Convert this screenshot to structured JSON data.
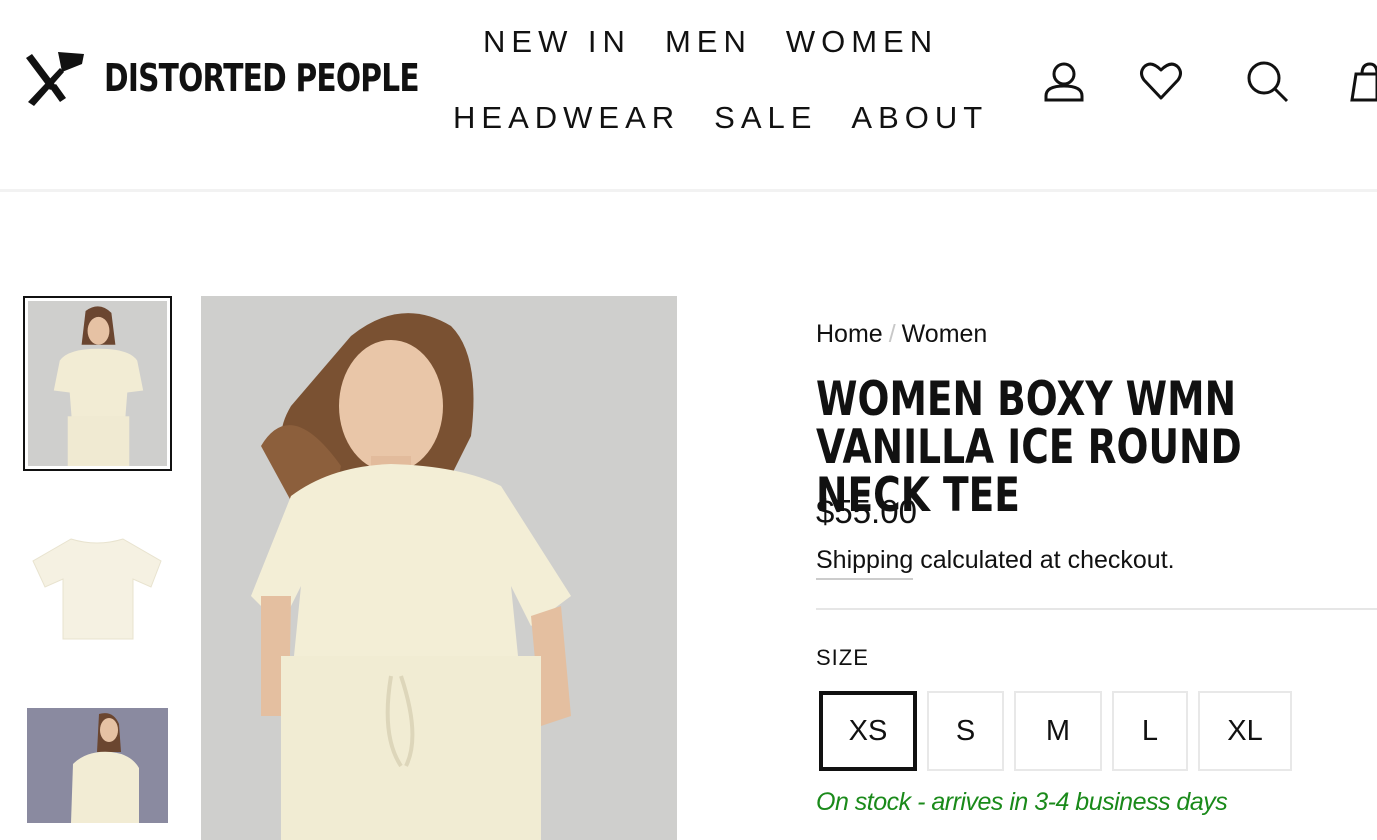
{
  "brand": {
    "name": "DISTORTED PEOPLE"
  },
  "nav": {
    "row1": [
      "NEW IN",
      "MEN",
      "WOMEN"
    ],
    "row2": [
      "HEADWEAR",
      "SALE",
      "ABOUT"
    ]
  },
  "header_icons": [
    "user-icon",
    "heart-icon",
    "search-icon",
    "cart-icon"
  ],
  "breadcrumb": {
    "home": "Home",
    "separator": "/",
    "current": "Women"
  },
  "product": {
    "title": "WOMEN BOXY WMN VANILLA ICE ROUND NECK TEE",
    "price": "$55.00",
    "shipping_link": "Shipping",
    "shipping_rest": " calculated at checkout.",
    "size_label": "SIZE",
    "sizes": [
      "XS",
      "S",
      "M",
      "L",
      "XL"
    ],
    "selected_size": "XS",
    "stock_text": "On stock - arrives in 3-4 business days"
  },
  "colors": {
    "stock": "#1a8a1a",
    "accent": "#111111"
  }
}
